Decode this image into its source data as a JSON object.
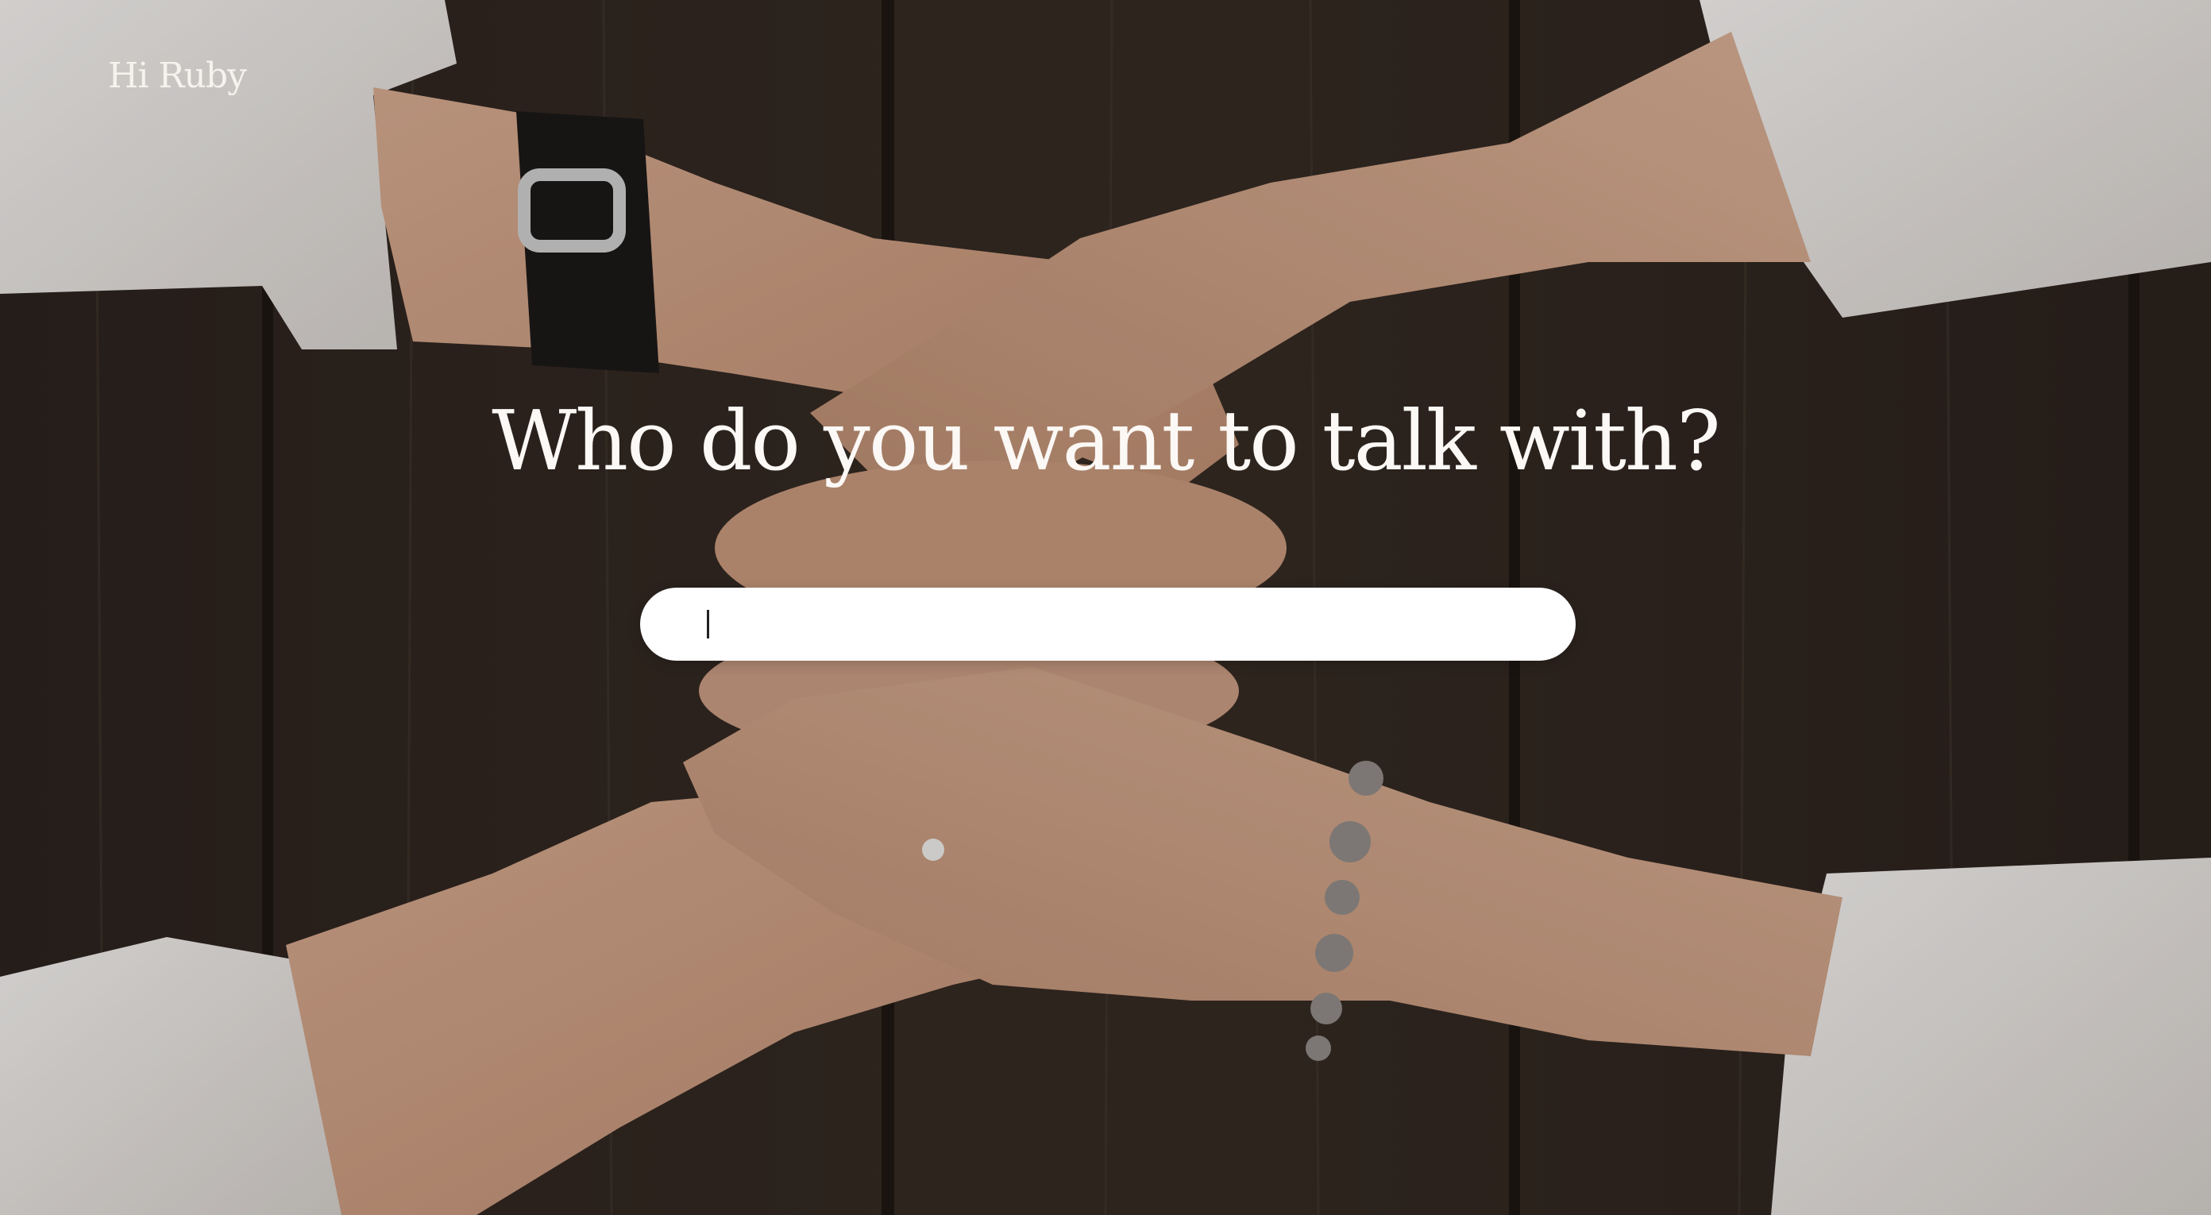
{
  "page": {
    "greeting": "Hi Ruby",
    "headline": "Who do you want to talk with?"
  },
  "search": {
    "value": "",
    "placeholder": ""
  },
  "background": {
    "description_icon": "holding-hands-photo",
    "colors": {
      "wood_dark": "#2a211c",
      "wood_mid": "#3b2f28",
      "skin": "#c89a80",
      "sleeve": "#e9e6e4"
    }
  }
}
